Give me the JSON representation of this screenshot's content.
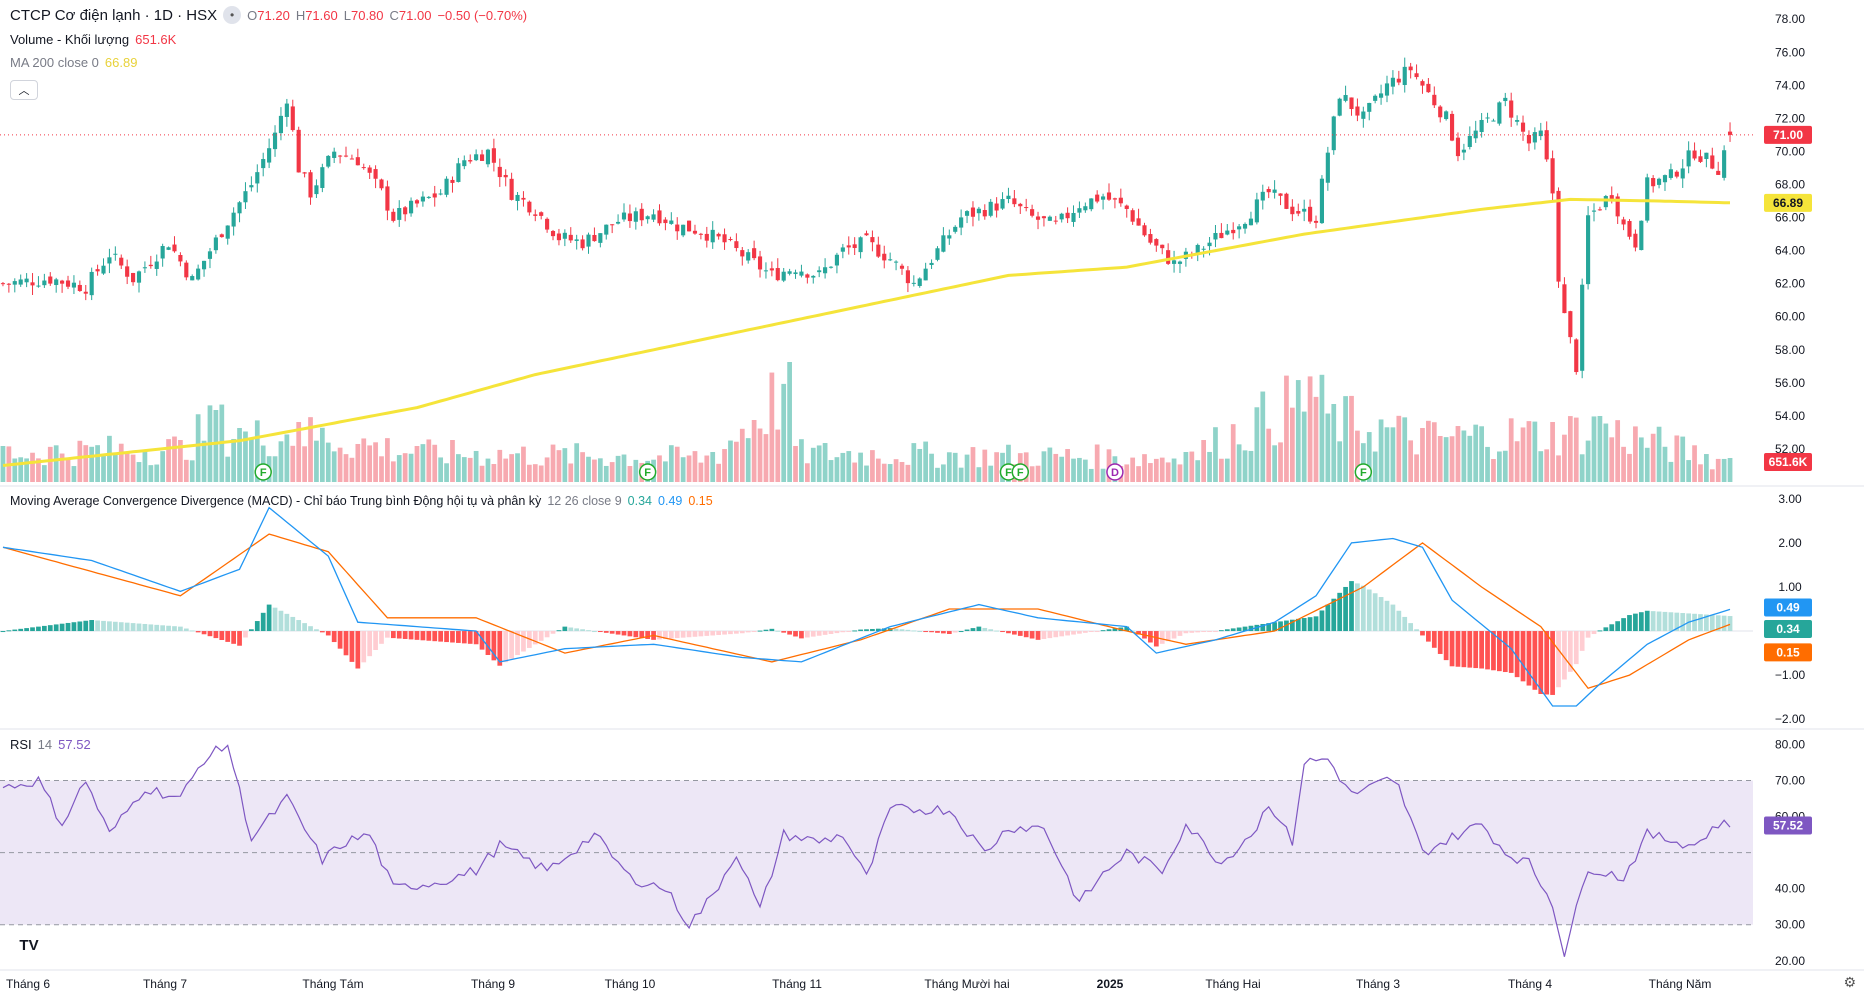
{
  "header": {
    "title": "CTCP Cơ điện lạnh · 1D · HSX",
    "o_label": "O",
    "o": "71.20",
    "h_label": "H",
    "h": "71.60",
    "l_label": "L",
    "l": "70.80",
    "c_label": "C",
    "c": "71.00",
    "change": "−0.50 (−0.70%)"
  },
  "legends": {
    "volume": {
      "label": "Volume - Khối lượng",
      "value": "651.6K"
    },
    "ma": {
      "label": "MA 200 close 0",
      "value": "66.89"
    },
    "macd": {
      "label": "Moving Average Convergence Divergence (MACD) - Chỉ báo Trung bình Động hội tụ và phân kỳ",
      "params": "12 26 close 9",
      "hist": "0.34",
      "macd": "0.49",
      "signal": "0.15"
    },
    "rsi": {
      "label": "RSI",
      "length": "14",
      "value": "57.52"
    }
  },
  "price_axis": {
    "ticks": [
      "78.00",
      "76.00",
      "74.00",
      "72.00",
      "70.00",
      "68.00",
      "66.00",
      "64.00",
      "62.00",
      "60.00",
      "58.00",
      "56.00",
      "54.00",
      "52.00"
    ],
    "last_price": "71.00",
    "ma_value": "66.89",
    "volume_value": "651.6K"
  },
  "macd_axis": {
    "ticks": [
      "3.00",
      "2.00",
      "1.00",
      "−1.00",
      "−2.00"
    ],
    "macd_label": "0.49",
    "hist_label": "0.34",
    "signal_label": "0.15"
  },
  "rsi_axis": {
    "ticks": [
      "80.00",
      "70.00",
      "60.00",
      "40.00",
      "30.00",
      "20.00"
    ],
    "value_label": "57.52"
  },
  "time_axis": [
    "Tháng 6",
    "Tháng 7",
    "Tháng Tám",
    "Tháng 9",
    "Tháng 10",
    "Tháng 11",
    "Tháng Mười hai",
    "2025",
    "Tháng Hai",
    "Tháng 3",
    "Tháng 4",
    "Tháng Năm"
  ],
  "event_markers": [
    "F",
    "F",
    "F",
    "F",
    "D",
    "F"
  ],
  "colors": {
    "up": "#26a69a",
    "down": "#f23645",
    "ma": "#f5e43a",
    "macd": "#2196f3",
    "signal": "#ff6d00",
    "rsi": "#7e57c2",
    "rsi_band": "#ede7f6",
    "vol_up": "#8fd3c9",
    "vol_down": "#f7a9b0"
  },
  "icons": {
    "tradingview_logo": "TV",
    "settings": "gear-icon",
    "collapse": "chevron-up-icon",
    "more": "circle-icon"
  },
  "chart_data": {
    "type": "candlestick",
    "symbol": "CTCP Cơ điện lạnh",
    "interval": "1D",
    "exchange": "HSX",
    "anchors": [
      [
        0,
        62.0
      ],
      [
        8,
        62.3
      ],
      [
        14,
        61.8
      ],
      [
        18,
        63.8
      ],
      [
        22,
        62.3
      ],
      [
        28,
        64.5
      ],
      [
        32,
        62.2
      ],
      [
        38,
        65.8
      ],
      [
        42,
        68.0
      ],
      [
        46,
        71.0
      ],
      [
        48,
        73.3
      ],
      [
        50,
        69.0
      ],
      [
        52,
        67.5
      ],
      [
        56,
        70.0
      ],
      [
        60,
        69.5
      ],
      [
        64,
        67.5
      ],
      [
        66,
        66.0
      ],
      [
        70,
        66.8
      ],
      [
        74,
        67.5
      ],
      [
        78,
        69.5
      ],
      [
        82,
        70.0
      ],
      [
        86,
        67.5
      ],
      [
        90,
        66.5
      ],
      [
        94,
        64.8
      ],
      [
        98,
        64.5
      ],
      [
        104,
        65.8
      ],
      [
        110,
        66.3
      ],
      [
        114,
        65.5
      ],
      [
        118,
        65.2
      ],
      [
        122,
        64.5
      ],
      [
        126,
        63.5
      ],
      [
        130,
        62.5
      ],
      [
        134,
        63.0
      ],
      [
        138,
        62.5
      ],
      [
        142,
        64.0
      ],
      [
        146,
        64.5
      ],
      [
        150,
        63.5
      ],
      [
        154,
        62.0
      ],
      [
        158,
        64.0
      ],
      [
        162,
        66.0
      ],
      [
        166,
        66.5
      ],
      [
        170,
        67.0
      ],
      [
        174,
        66.0
      ],
      [
        178,
        65.5
      ],
      [
        182,
        66.8
      ],
      [
        186,
        67.3
      ],
      [
        190,
        66.5
      ],
      [
        194,
        64.5
      ],
      [
        198,
        63.2
      ],
      [
        202,
        64.0
      ],
      [
        206,
        65.0
      ],
      [
        210,
        66.0
      ],
      [
        214,
        67.5
      ],
      [
        218,
        66.5
      ],
      [
        222,
        66.0
      ],
      [
        224,
        70.0
      ],
      [
        226,
        73.5
      ],
      [
        230,
        72.0
      ],
      [
        234,
        74.0
      ],
      [
        238,
        75.0
      ],
      [
        240,
        74.0
      ],
      [
        244,
        72.0
      ],
      [
        246,
        70.0
      ],
      [
        250,
        71.5
      ],
      [
        254,
        73.0
      ],
      [
        258,
        70.5
      ],
      [
        260,
        71.0
      ],
      [
        262,
        67.5
      ],
      [
        263,
        62.5
      ],
      [
        264,
        60.0
      ],
      [
        266,
        57.0
      ],
      [
        268,
        66.0
      ],
      [
        272,
        67.5
      ],
      [
        274,
        65.5
      ],
      [
        276,
        64.5
      ],
      [
        278,
        68.0
      ],
      [
        282,
        68.5
      ],
      [
        286,
        70.0
      ],
      [
        290,
        69.0
      ],
      [
        292,
        71.0
      ]
    ],
    "ma200_anchors": [
      [
        0,
        51.0
      ],
      [
        40,
        52.5
      ],
      [
        70,
        54.5
      ],
      [
        90,
        56.5
      ],
      [
        130,
        59.5
      ],
      [
        170,
        62.5
      ],
      [
        190,
        63.0
      ],
      [
        220,
        65.0
      ],
      [
        250,
        66.5
      ],
      [
        265,
        67.1
      ],
      [
        280,
        67.0
      ],
      [
        292,
        66.89
      ]
    ],
    "volume_anchors": [
      [
        0,
        0.3
      ],
      [
        30,
        0.35
      ],
      [
        36,
        0.6
      ],
      [
        40,
        0.45
      ],
      [
        50,
        0.5
      ],
      [
        70,
        0.3
      ],
      [
        120,
        0.25
      ],
      [
        133,
        1.0
      ],
      [
        134,
        0.3
      ],
      [
        200,
        0.25
      ],
      [
        221,
        0.88
      ],
      [
        225,
        0.65
      ],
      [
        240,
        0.45
      ],
      [
        262,
        0.5
      ],
      [
        270,
        0.55
      ],
      [
        292,
        0.2
      ]
    ],
    "macd_anchors": [
      [
        0,
        1.9
      ],
      [
        15,
        1.6
      ],
      [
        30,
        0.9
      ],
      [
        40,
        1.4
      ],
      [
        45,
        2.8
      ],
      [
        55,
        1.7
      ],
      [
        60,
        0.2
      ],
      [
        70,
        0.1
      ],
      [
        80,
        0.0
      ],
      [
        84,
        -0.7
      ],
      [
        95,
        -0.4
      ],
      [
        110,
        -0.3
      ],
      [
        125,
        -0.6
      ],
      [
        135,
        -0.7
      ],
      [
        150,
        0.1
      ],
      [
        165,
        0.6
      ],
      [
        175,
        0.3
      ],
      [
        190,
        0.1
      ],
      [
        195,
        -0.5
      ],
      [
        205,
        -0.2
      ],
      [
        215,
        0.2
      ],
      [
        222,
        0.8
      ],
      [
        228,
        2.0
      ],
      [
        235,
        2.1
      ],
      [
        240,
        1.9
      ],
      [
        245,
        0.7
      ],
      [
        255,
        -0.4
      ],
      [
        262,
        -1.7
      ],
      [
        266,
        -1.7
      ],
      [
        270,
        -1.2
      ],
      [
        278,
        -0.3
      ],
      [
        285,
        0.2
      ],
      [
        292,
        0.49
      ]
    ],
    "signal_anchors": [
      [
        0,
        1.9
      ],
      [
        30,
        0.8
      ],
      [
        45,
        2.2
      ],
      [
        55,
        1.8
      ],
      [
        65,
        0.3
      ],
      [
        80,
        0.3
      ],
      [
        95,
        -0.5
      ],
      [
        110,
        -0.1
      ],
      [
        130,
        -0.7
      ],
      [
        145,
        -0.2
      ],
      [
        160,
        0.5
      ],
      [
        175,
        0.5
      ],
      [
        190,
        0.0
      ],
      [
        200,
        -0.3
      ],
      [
        215,
        0.0
      ],
      [
        230,
        1.0
      ],
      [
        240,
        2.0
      ],
      [
        250,
        1.0
      ],
      [
        260,
        0.1
      ],
      [
        268,
        -1.3
      ],
      [
        275,
        -1.0
      ],
      [
        285,
        -0.2
      ],
      [
        292,
        0.15
      ]
    ],
    "rsi_anchors": [
      [
        0,
        68
      ],
      [
        6,
        70
      ],
      [
        10,
        58
      ],
      [
        14,
        70
      ],
      [
        18,
        55
      ],
      [
        24,
        68
      ],
      [
        30,
        65
      ],
      [
        34,
        76
      ],
      [
        38,
        80
      ],
      [
        42,
        54
      ],
      [
        48,
        65
      ],
      [
        54,
        48
      ],
      [
        58,
        53
      ],
      [
        62,
        55
      ],
      [
        66,
        40
      ],
      [
        74,
        42
      ],
      [
        80,
        45
      ],
      [
        84,
        52
      ],
      [
        92,
        45
      ],
      [
        100,
        55
      ],
      [
        106,
        43
      ],
      [
        112,
        40
      ],
      [
        116,
        30
      ],
      [
        120,
        38
      ],
      [
        124,
        50
      ],
      [
        128,
        34
      ],
      [
        132,
        55
      ],
      [
        138,
        53
      ],
      [
        142,
        55
      ],
      [
        146,
        43
      ],
      [
        150,
        62
      ],
      [
        156,
        62
      ],
      [
        160,
        62
      ],
      [
        166,
        50
      ],
      [
        170,
        57
      ],
      [
        176,
        57
      ],
      [
        182,
        36
      ],
      [
        186,
        44
      ],
      [
        190,
        50
      ],
      [
        196,
        45
      ],
      [
        200,
        58
      ],
      [
        206,
        47
      ],
      [
        212,
        57
      ],
      [
        214,
        64
      ],
      [
        218,
        53
      ],
      [
        220,
        75
      ],
      [
        224,
        76
      ],
      [
        228,
        66
      ],
      [
        234,
        70
      ],
      [
        236,
        68
      ],
      [
        240,
        50
      ],
      [
        246,
        55
      ],
      [
        250,
        58
      ],
      [
        254,
        50
      ],
      [
        258,
        47
      ],
      [
        262,
        36
      ],
      [
        264,
        22
      ],
      [
        268,
        46
      ],
      [
        274,
        43
      ],
      [
        278,
        55
      ],
      [
        286,
        52
      ],
      [
        290,
        58
      ],
      [
        292,
        57.5
      ]
    ],
    "n_candles": 293,
    "ylim_price": [
      50.0,
      78.8
    ],
    "ylim_macd": [
      -2.2,
      3.2
    ],
    "ylim_rsi": [
      18,
      84
    ],
    "rsi_levels": [
      70,
      50,
      30
    ],
    "marker_positions": [
      44,
      109,
      170,
      172,
      188,
      230
    ]
  }
}
